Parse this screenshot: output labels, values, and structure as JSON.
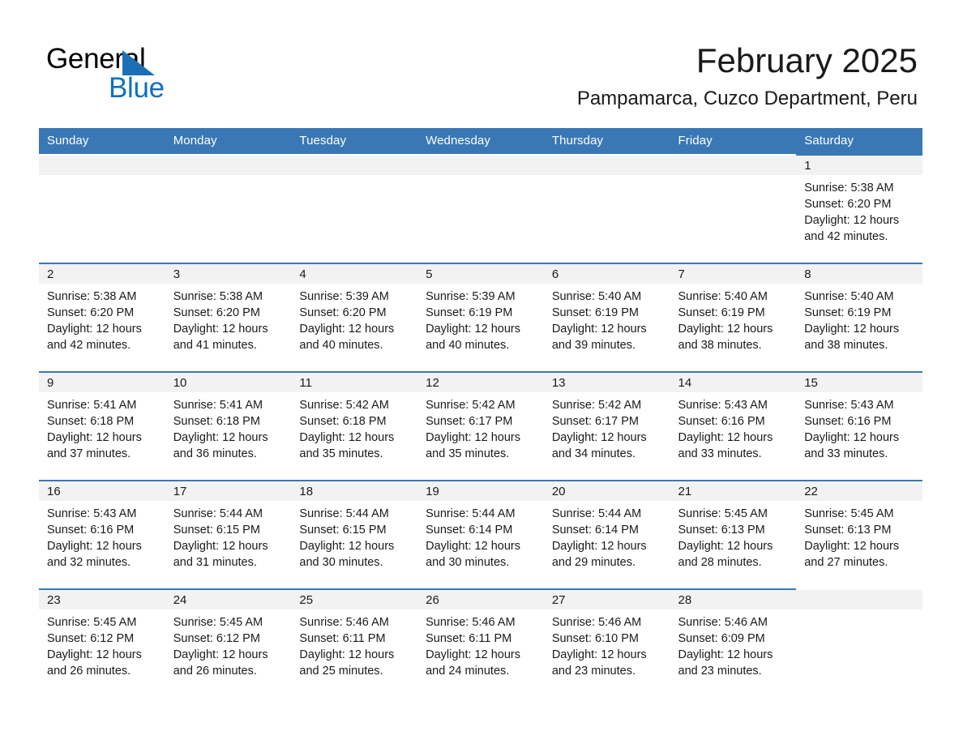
{
  "brand": {
    "name_dark": "General",
    "name_light": "Blue",
    "accent_color": "#1270bf",
    "header_color": "#3a78b5"
  },
  "header": {
    "month_title": "February 2025",
    "location": "Pampamarca, Cuzco Department, Peru"
  },
  "calendar": {
    "weekday_headers": [
      "Sunday",
      "Monday",
      "Tuesday",
      "Wednesday",
      "Thursday",
      "Friday",
      "Saturday"
    ],
    "weeks": [
      [
        {
          "day": "",
          "lines": []
        },
        {
          "day": "",
          "lines": []
        },
        {
          "day": "",
          "lines": []
        },
        {
          "day": "",
          "lines": []
        },
        {
          "day": "",
          "lines": []
        },
        {
          "day": "",
          "lines": []
        },
        {
          "day": "1",
          "lines": [
            "Sunrise: 5:38 AM",
            "Sunset: 6:20 PM",
            "Daylight: 12 hours",
            "and 42 minutes."
          ]
        }
      ],
      [
        {
          "day": "2",
          "lines": [
            "Sunrise: 5:38 AM",
            "Sunset: 6:20 PM",
            "Daylight: 12 hours",
            "and 42 minutes."
          ]
        },
        {
          "day": "3",
          "lines": [
            "Sunrise: 5:38 AM",
            "Sunset: 6:20 PM",
            "Daylight: 12 hours",
            "and 41 minutes."
          ]
        },
        {
          "day": "4",
          "lines": [
            "Sunrise: 5:39 AM",
            "Sunset: 6:20 PM",
            "Daylight: 12 hours",
            "and 40 minutes."
          ]
        },
        {
          "day": "5",
          "lines": [
            "Sunrise: 5:39 AM",
            "Sunset: 6:19 PM",
            "Daylight: 12 hours",
            "and 40 minutes."
          ]
        },
        {
          "day": "6",
          "lines": [
            "Sunrise: 5:40 AM",
            "Sunset: 6:19 PM",
            "Daylight: 12 hours",
            "and 39 minutes."
          ]
        },
        {
          "day": "7",
          "lines": [
            "Sunrise: 5:40 AM",
            "Sunset: 6:19 PM",
            "Daylight: 12 hours",
            "and 38 minutes."
          ]
        },
        {
          "day": "8",
          "lines": [
            "Sunrise: 5:40 AM",
            "Sunset: 6:19 PM",
            "Daylight: 12 hours",
            "and 38 minutes."
          ]
        }
      ],
      [
        {
          "day": "9",
          "lines": [
            "Sunrise: 5:41 AM",
            "Sunset: 6:18 PM",
            "Daylight: 12 hours",
            "and 37 minutes."
          ]
        },
        {
          "day": "10",
          "lines": [
            "Sunrise: 5:41 AM",
            "Sunset: 6:18 PM",
            "Daylight: 12 hours",
            "and 36 minutes."
          ]
        },
        {
          "day": "11",
          "lines": [
            "Sunrise: 5:42 AM",
            "Sunset: 6:18 PM",
            "Daylight: 12 hours",
            "and 35 minutes."
          ]
        },
        {
          "day": "12",
          "lines": [
            "Sunrise: 5:42 AM",
            "Sunset: 6:17 PM",
            "Daylight: 12 hours",
            "and 35 minutes."
          ]
        },
        {
          "day": "13",
          "lines": [
            "Sunrise: 5:42 AM",
            "Sunset: 6:17 PM",
            "Daylight: 12 hours",
            "and 34 minutes."
          ]
        },
        {
          "day": "14",
          "lines": [
            "Sunrise: 5:43 AM",
            "Sunset: 6:16 PM",
            "Daylight: 12 hours",
            "and 33 minutes."
          ]
        },
        {
          "day": "15",
          "lines": [
            "Sunrise: 5:43 AM",
            "Sunset: 6:16 PM",
            "Daylight: 12 hours",
            "and 33 minutes."
          ]
        }
      ],
      [
        {
          "day": "16",
          "lines": [
            "Sunrise: 5:43 AM",
            "Sunset: 6:16 PM",
            "Daylight: 12 hours",
            "and 32 minutes."
          ]
        },
        {
          "day": "17",
          "lines": [
            "Sunrise: 5:44 AM",
            "Sunset: 6:15 PM",
            "Daylight: 12 hours",
            "and 31 minutes."
          ]
        },
        {
          "day": "18",
          "lines": [
            "Sunrise: 5:44 AM",
            "Sunset: 6:15 PM",
            "Daylight: 12 hours",
            "and 30 minutes."
          ]
        },
        {
          "day": "19",
          "lines": [
            "Sunrise: 5:44 AM",
            "Sunset: 6:14 PM",
            "Daylight: 12 hours",
            "and 30 minutes."
          ]
        },
        {
          "day": "20",
          "lines": [
            "Sunrise: 5:44 AM",
            "Sunset: 6:14 PM",
            "Daylight: 12 hours",
            "and 29 minutes."
          ]
        },
        {
          "day": "21",
          "lines": [
            "Sunrise: 5:45 AM",
            "Sunset: 6:13 PM",
            "Daylight: 12 hours",
            "and 28 minutes."
          ]
        },
        {
          "day": "22",
          "lines": [
            "Sunrise: 5:45 AM",
            "Sunset: 6:13 PM",
            "Daylight: 12 hours",
            "and 27 minutes."
          ]
        }
      ],
      [
        {
          "day": "23",
          "lines": [
            "Sunrise: 5:45 AM",
            "Sunset: 6:12 PM",
            "Daylight: 12 hours",
            "and 26 minutes."
          ]
        },
        {
          "day": "24",
          "lines": [
            "Sunrise: 5:45 AM",
            "Sunset: 6:12 PM",
            "Daylight: 12 hours",
            "and 26 minutes."
          ]
        },
        {
          "day": "25",
          "lines": [
            "Sunrise: 5:46 AM",
            "Sunset: 6:11 PM",
            "Daylight: 12 hours",
            "and 25 minutes."
          ]
        },
        {
          "day": "26",
          "lines": [
            "Sunrise: 5:46 AM",
            "Sunset: 6:11 PM",
            "Daylight: 12 hours",
            "and 24 minutes."
          ]
        },
        {
          "day": "27",
          "lines": [
            "Sunrise: 5:46 AM",
            "Sunset: 6:10 PM",
            "Daylight: 12 hours",
            "and 23 minutes."
          ]
        },
        {
          "day": "28",
          "lines": [
            "Sunrise: 5:46 AM",
            "Sunset: 6:09 PM",
            "Daylight: 12 hours",
            "and 23 minutes."
          ]
        },
        {
          "day": "",
          "lines": []
        }
      ]
    ]
  }
}
